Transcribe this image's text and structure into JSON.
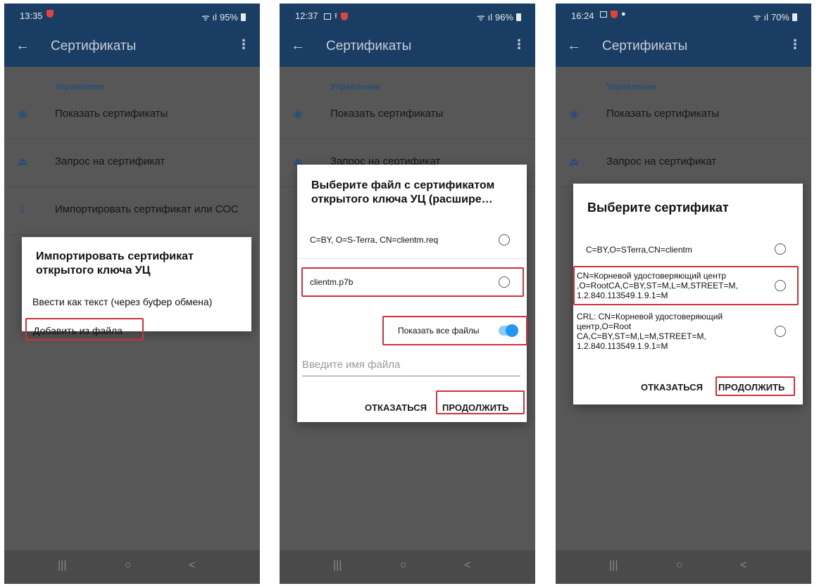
{
  "colors": {
    "appbar": "#193d63",
    "scrim": "#575757",
    "highlight": "#cf3239",
    "accent": "#2196f3",
    "section": "#254e77"
  },
  "common": {
    "title": "Сертификаты",
    "back_icon": "arrow-left-icon",
    "menu_icon": "more-vert-icon",
    "section": "Управление",
    "items": [
      {
        "label": "Показать сертификаты",
        "icon": "eye-icon"
      },
      {
        "label": "Запрос на сертификат",
        "icon": "request-icon"
      },
      {
        "label": "Импортировать сертификат или СОС",
        "icon": "import-icon"
      }
    ],
    "nav": {
      "recents": "|||",
      "home": "○",
      "back": "<"
    }
  },
  "screens": [
    {
      "time": "13:35",
      "battery": "95%"
    },
    {
      "time": "12:37",
      "battery": "96%"
    },
    {
      "time": "16:24",
      "battery": "70%"
    }
  ],
  "dialog1": {
    "title": "Импортировать сертификат открытого ключа УЦ",
    "options": [
      "Ввести как текст (через буфер обмена)",
      "Добавить из файла"
    ]
  },
  "dialog2": {
    "title": "Выберите файл с сертификатом открытого ключа УЦ (расшире…",
    "files": [
      "C=BY, O=S-Terra, CN=clientm.req",
      "clientm.p7b"
    ],
    "show_all_label": "Показать все файлы",
    "show_all_on": true,
    "filename_placeholder": "Введите имя файла",
    "cancel": "ОТКАЗАТЬСЯ",
    "continue": "ПРОДОЛЖИТЬ"
  },
  "dialog3": {
    "title": "Выберите сертификат",
    "options": [
      "C=BY,O=STerra,CN=clientm",
      "CN=Корневой удостоверяющий центр ,O=RootCA,C=BY,ST=M,L=M,STREET=M, 1.2.840.113549.1.9.1=M",
      "CRL: CN=Корневой удостоверяющий центр,O=Root CA,C=BY,ST=M,L=M,STREET=M, 1.2.840.113549.1.9.1=M"
    ],
    "cancel": "ОТКАЗАТЬСЯ",
    "continue": "ПРОДОЛЖИТЬ"
  }
}
